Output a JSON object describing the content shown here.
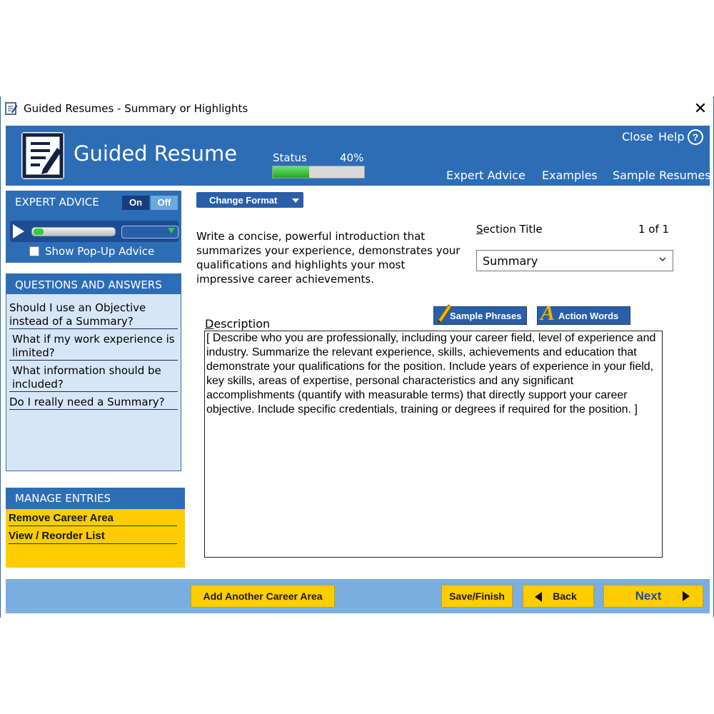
{
  "window": {
    "title": "Guided Resumes - Summary or Highlights",
    "close_glyph": "✕"
  },
  "header": {
    "app_title": "Guided Resume",
    "status_label": "Status",
    "status_percent": "40%",
    "status_progress": 0.4,
    "links": {
      "close": "Close",
      "help": "Help",
      "help_glyph": "?",
      "expert_advice": "Expert Advice",
      "examples": "Examples",
      "sample_resumes": "Sample Resumes"
    }
  },
  "expert_advice": {
    "title": "EXPERT ADVICE",
    "on": "On",
    "off": "Off",
    "popup_label": "Show Pop-Up Advice",
    "popup_checked": false
  },
  "qa": {
    "title": "QUESTIONS AND ANSWERS",
    "items": [
      {
        "text": "Should I use an Objective instead of a Summary?"
      },
      {
        "text": "What if my work experience is limited?"
      },
      {
        "text": "What information should be included?"
      },
      {
        "text": "Do I really need a Summary?"
      }
    ]
  },
  "manage": {
    "title": "MANAGE ENTRIES",
    "items": [
      {
        "text": "Remove Career Area"
      },
      {
        "text": "View / Reorder List"
      }
    ]
  },
  "main": {
    "change_format": "Change Format",
    "instructions": "Write a concise, powerful introduction that summarizes your experience, demonstrates your qualifications and highlights your most impressive career achievements.",
    "section_title_label": "Section Title",
    "page_count": "1 of 1",
    "section_title_value": "Summary",
    "description_label": "Description",
    "sample_phrases": "Sample Phrases",
    "action_words": "Action Words",
    "action_words_glyph": "A",
    "description_text": "[ Describe who you are professionally, including your career field, level of experience and industry. Summarize the relevant experience, skills, achievements and education that demonstrate your qualifications for the position.  Include years of experience in your field, key skills, areas of expertise, personal characteristics and any significant accomplishments (quantify with measurable terms) that directly support your career objective.  Include specific credentials, training or degrees if required for the position. ]"
  },
  "footer": {
    "add_career_area": "Add Another Career Area",
    "save_finish": "Save/Finish",
    "back": "Back",
    "next": "Next"
  },
  "colors": {
    "brand_blue": "#2d6db6",
    "accent_yellow": "#ffcc00",
    "panel_light": "#d7e6f7",
    "footer_blue": "#7aaee0"
  },
  "icons": [
    "resume-logo-icon",
    "help-circle-icon",
    "play-icon",
    "pencil-icon",
    "chevron-down-icon",
    "back-arrow-icon",
    "next-arrow-icon"
  ]
}
